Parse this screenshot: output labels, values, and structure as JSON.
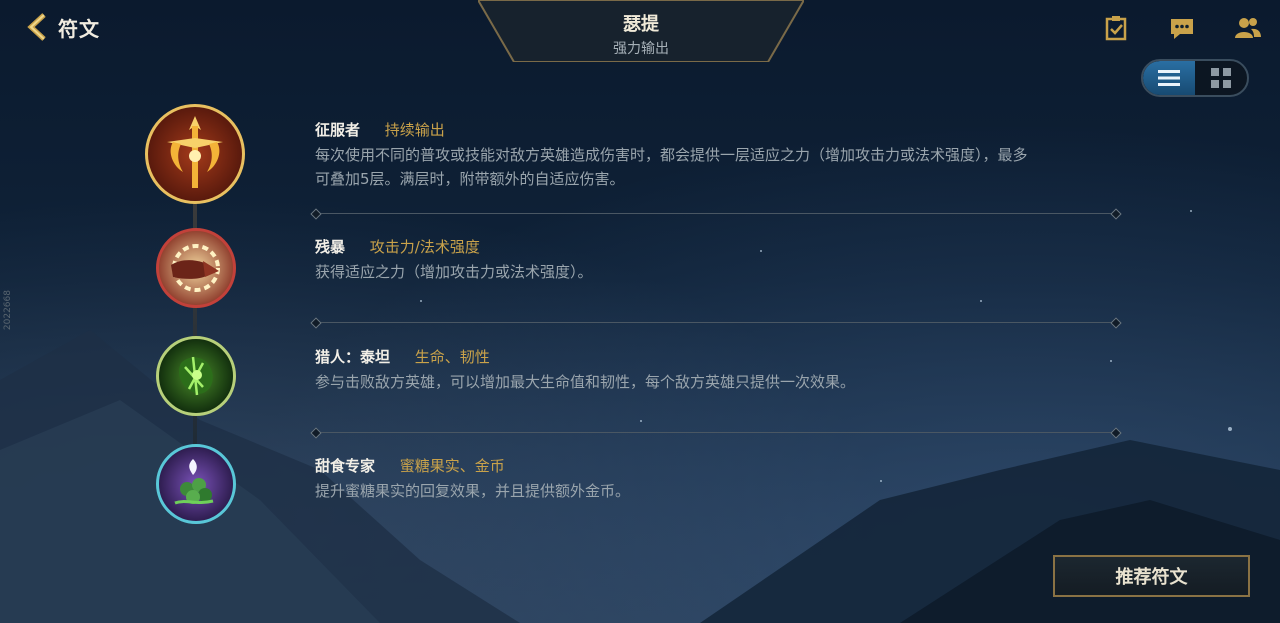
{
  "header": {
    "back_label": "符文",
    "champion_name": "瑟提",
    "champion_subtitle": "强力输出",
    "icons": [
      "clipboard-check-icon",
      "chat-icon",
      "friends-icon"
    ]
  },
  "view_toggle": {
    "active": "list",
    "options": [
      "list-icon",
      "grid-icon"
    ]
  },
  "runes": [
    {
      "name": "征服者",
      "tag": "持续输出",
      "desc_line1": "每次使用不同的普攻或技能对敌方英雄造成伤害时，都会提供一层适应之力（增加攻击力或法术强度），最多",
      "desc_line2": "可叠加5层。满层时，附带额外的自适应伤害。",
      "icon": "conqueror-icon",
      "ring_color": "#e8c060"
    },
    {
      "name": "残暴",
      "tag": "攻击力/法术强度",
      "desc_line1": "获得适应之力（增加攻击力或法术强度）。",
      "desc_line2": "",
      "icon": "brutal-icon",
      "ring_color": "#c2413a"
    },
    {
      "name": "猎人：泰坦",
      "tag": "生命、韧性",
      "desc_line1": "参与击败敌方英雄，可以增加最大生命值和韧性，每个敌方英雄只提供一次效果。",
      "desc_line2": "",
      "icon": "hunter-titan-icon",
      "ring_color": "#b7d07a"
    },
    {
      "name": "甜食专家",
      "tag": "蜜糖果实、金币",
      "desc_line1": "提升蜜糖果实的回复效果，并且提供额外金币。",
      "desc_line2": "",
      "icon": "sweet-tooth-icon",
      "ring_color": "#59c7d8"
    }
  ],
  "side_id": "2022668",
  "recommend_button": "推荐符文",
  "colors": {
    "accent_gold": "#c9a24a",
    "toggle_active": "#2a6fa3"
  }
}
